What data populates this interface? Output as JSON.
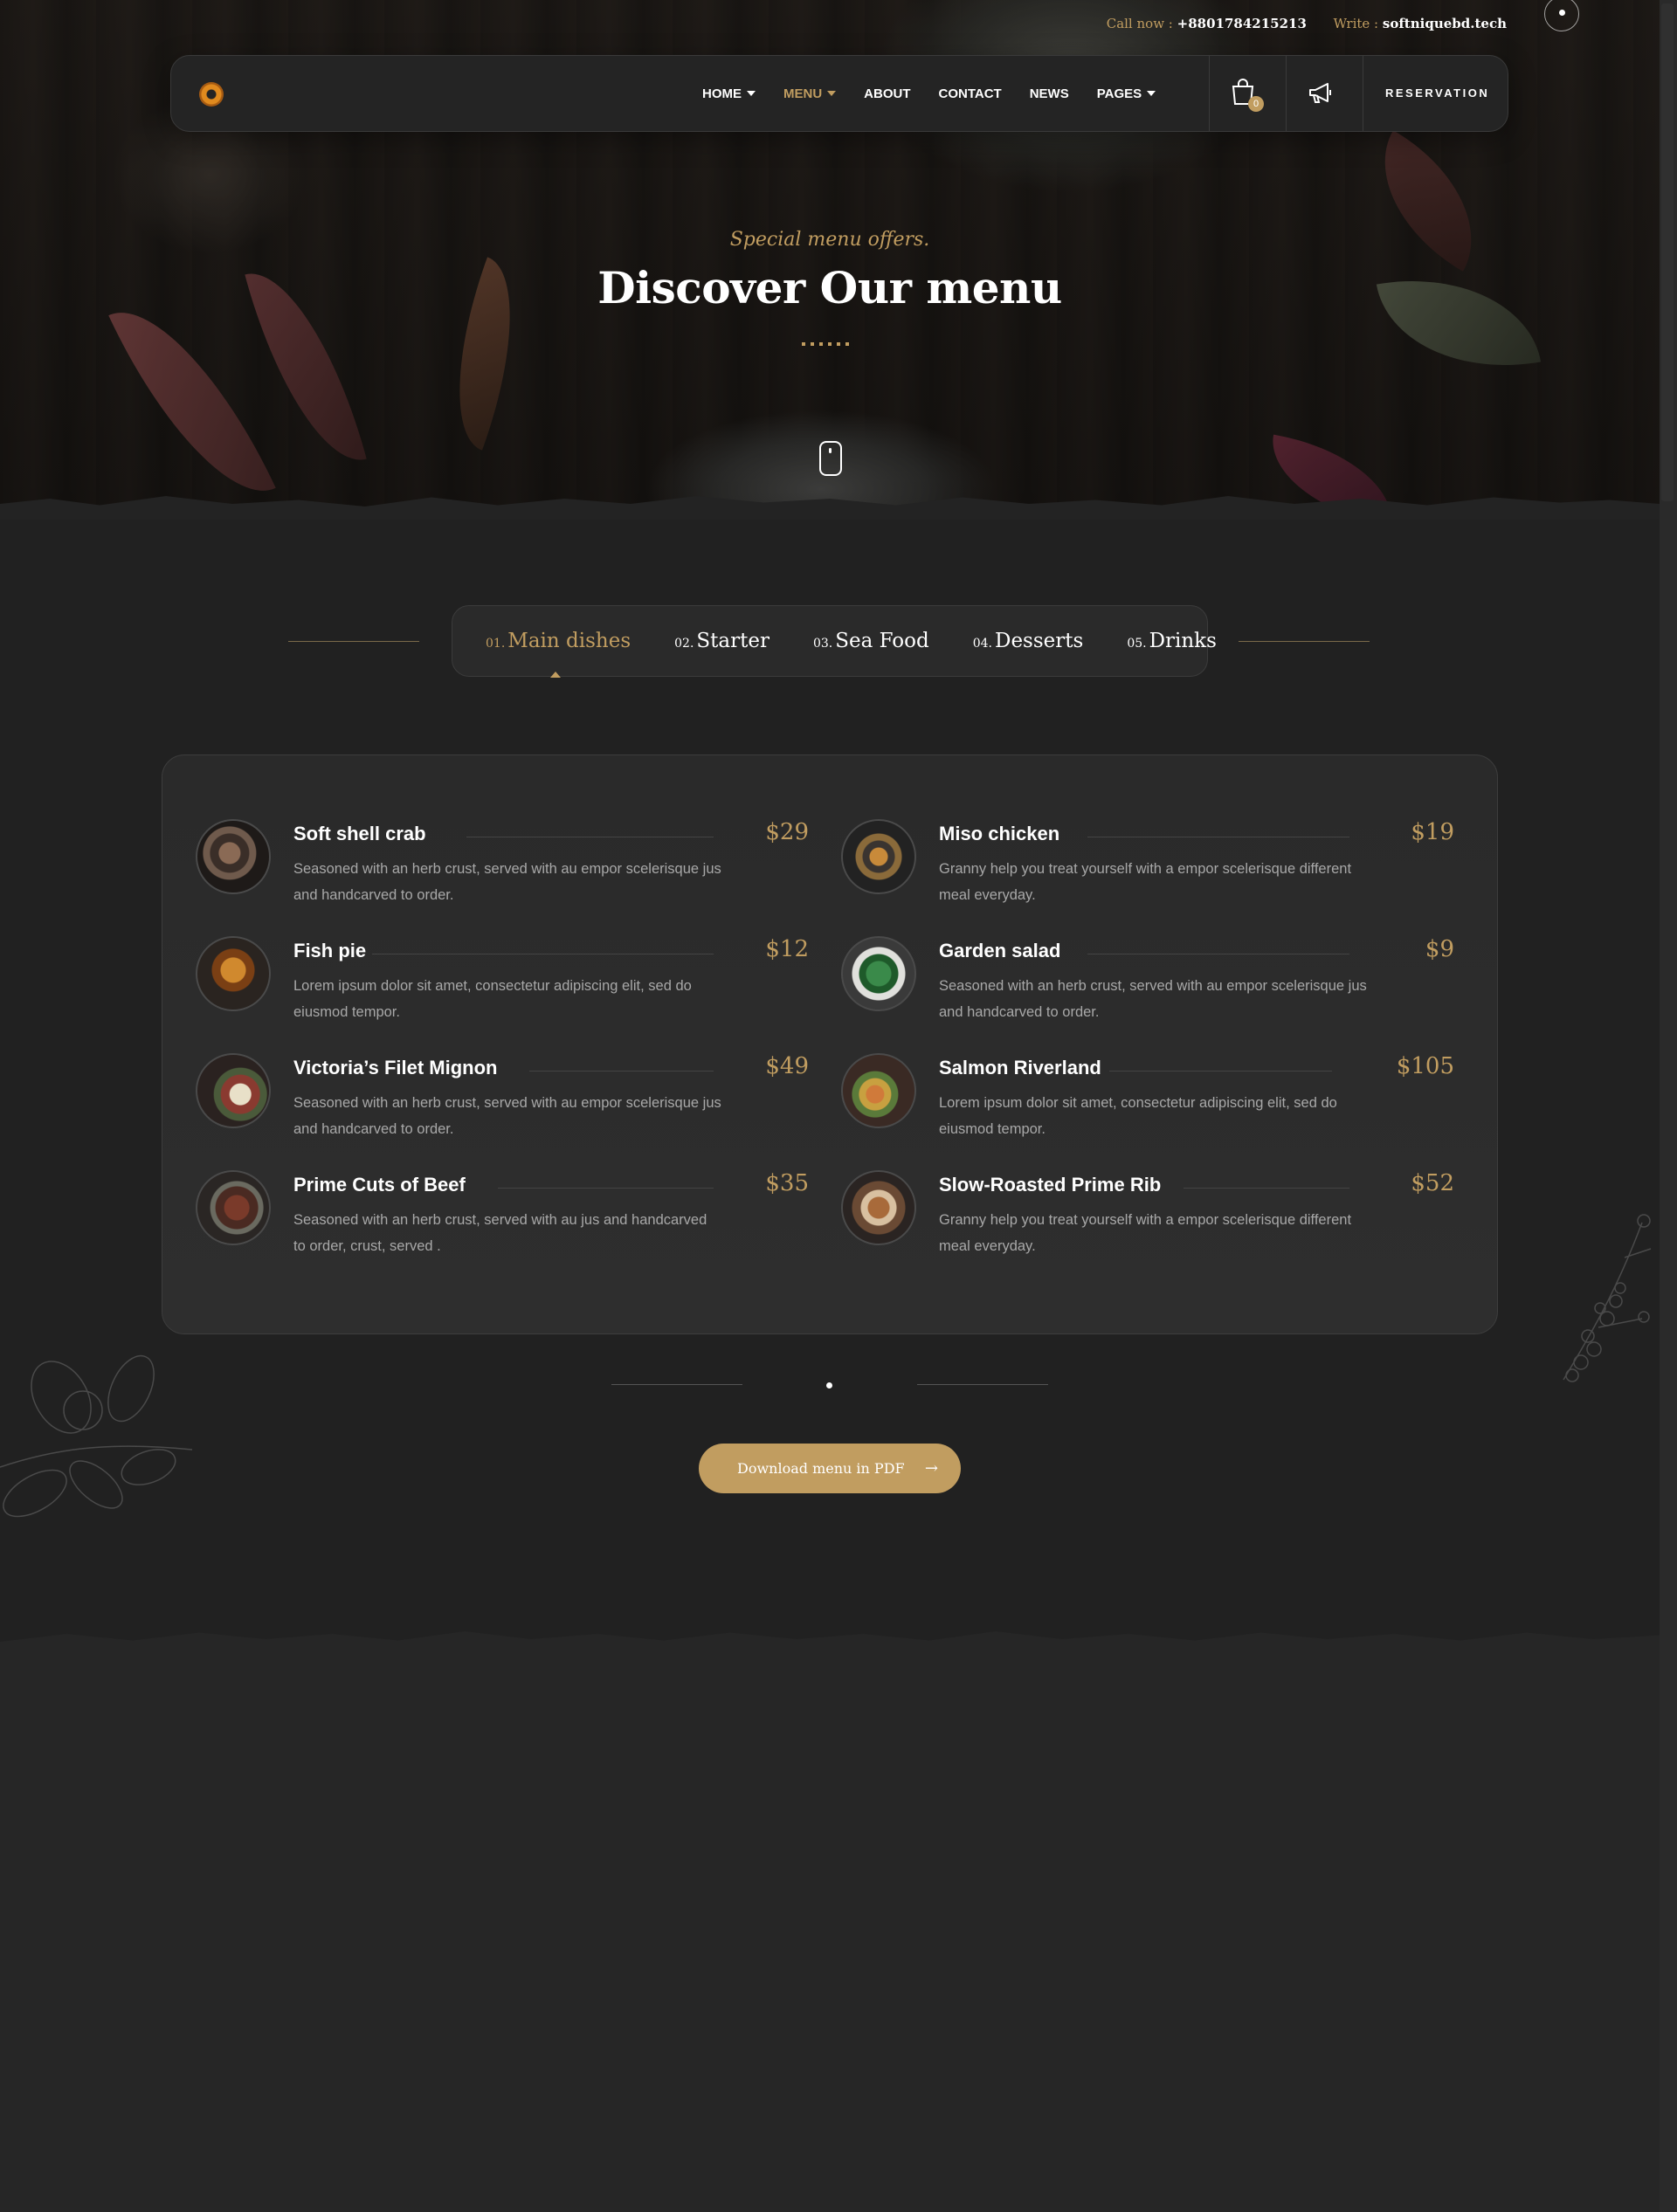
{
  "topbar": {
    "call_label": "Call now :",
    "call_value": "+8801784215213",
    "write_label": "Write :",
    "write_value": "softniquebd.tech"
  },
  "nav": {
    "items": [
      {
        "label": "HOME",
        "has_caret": true
      },
      {
        "label": "MENU",
        "has_caret": true,
        "active": true
      },
      {
        "label": "ABOUT"
      },
      {
        "label": "CONTACT"
      },
      {
        "label": "NEWS"
      },
      {
        "label": "PAGES",
        "has_caret": true
      }
    ],
    "cart_count": "0",
    "cart_icon": "shopping-bag-icon",
    "promo_icon": "megaphone-icon",
    "reservation_label": "RESERVATION"
  },
  "hero": {
    "subtitle": "Special menu offers.",
    "title": "Discover Our menu"
  },
  "tabs": [
    {
      "num": "01.",
      "name": "Main dishes",
      "active": true
    },
    {
      "num": "02.",
      "name": "Starter"
    },
    {
      "num": "03.",
      "name": "Sea Food"
    },
    {
      "num": "04.",
      "name": "Desserts"
    },
    {
      "num": "05.",
      "name": "Drinks"
    }
  ],
  "menu_items": [
    {
      "title": "Soft shell crab",
      "price": "$29",
      "desc": "Seasoned with an herb crust, served with au empor scelerisque jus and handcarved to order."
    },
    {
      "title": "Miso chicken",
      "price": "$19",
      "desc": "Granny help you treat yourself with a empor scelerisque different meal everyday."
    },
    {
      "title": "Fish pie",
      "price": "$12",
      "desc": "Lorem ipsum dolor sit amet, consectetur adipiscing elit, sed do eiusmod tempor."
    },
    {
      "title": "Garden salad",
      "price": "$9",
      "desc": "Seasoned with an herb crust, served with au empor scelerisque jus and handcarved to order."
    },
    {
      "title": "Victoria’s Filet Mignon",
      "price": "$49",
      "desc": "Seasoned with an herb crust, served with au empor scelerisque jus and handcarved to order."
    },
    {
      "title": "Salmon Riverland",
      "price": "$105",
      "desc": "Lorem ipsum dolor sit amet, consectetur adipiscing elit, sed do eiusmod tempor."
    },
    {
      "title": "Prime Cuts of Beef",
      "price": "$35",
      "desc": "Seasoned with an herb crust, served with au jus and handcarved to order, crust, served ."
    },
    {
      "title": "Slow-Roasted Prime Rib",
      "price": "$52",
      "desc": "Granny help you treat yourself with a empor scelerisque different meal everyday."
    }
  ],
  "download": {
    "label": "Download menu in PDF",
    "arrow": "→"
  },
  "colors": {
    "accent": "#c19d60",
    "background": "#262626",
    "card": "#2c2c2c"
  }
}
